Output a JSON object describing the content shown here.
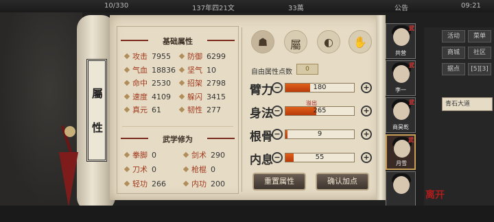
{
  "topbar": {
    "exp": "10/330",
    "time_label": "137年四21文",
    "coins": "33萬",
    "notice": "公告",
    "clock": "09:21"
  },
  "scroll_tag": [
    "屬",
    "性"
  ],
  "basic": {
    "title": "基础属性",
    "stats": [
      {
        "label": "攻击",
        "value": "7955"
      },
      {
        "label": "防御",
        "value": "6299"
      },
      {
        "label": "气血",
        "value": "18836"
      },
      {
        "label": "坚气",
        "value": "10"
      },
      {
        "label": "命中",
        "value": "2530"
      },
      {
        "label": "招架",
        "value": "2798"
      },
      {
        "label": "速度",
        "value": "4109"
      },
      {
        "label": "躲闪",
        "value": "3415"
      },
      {
        "label": "真元",
        "value": "61"
      },
      {
        "label": "韧性",
        "value": "277"
      }
    ]
  },
  "martial": {
    "title": "武学修为",
    "stats": [
      {
        "label": "拳脚",
        "value": "0"
      },
      {
        "label": "剑术",
        "value": "290"
      },
      {
        "label": "刀术",
        "value": "0"
      },
      {
        "label": "枪棍",
        "value": "0"
      },
      {
        "label": "轻功",
        "value": "266"
      },
      {
        "label": "内功",
        "value": "200"
      }
    ]
  },
  "tabs": [
    {
      "name": "character-tab",
      "glyph": "☗"
    },
    {
      "name": "attributes-tab",
      "glyph": "屬"
    },
    {
      "name": "skills-tab",
      "glyph": "◐"
    },
    {
      "name": "body-tab",
      "glyph": "✋"
    }
  ],
  "free_points": {
    "label": "自由属性点数",
    "value": "0"
  },
  "attributes": [
    {
      "name": "臂力",
      "value": "180",
      "fill": 0.36
    },
    {
      "name": "身法",
      "value": "265",
      "fill": 0.45
    },
    {
      "name": "根骨",
      "value": "9",
      "fill": 0.03
    },
    {
      "name": "内息",
      "value": "55",
      "fill": 0.12
    }
  ],
  "overflow_label": "溢出",
  "buttons": {
    "reset": "重置属性",
    "confirm": "确认加点"
  },
  "party": [
    {
      "name": "共营",
      "level": "武"
    },
    {
      "name": "李一",
      "level": "武"
    },
    {
      "name": "商昊乾",
      "level": "武"
    },
    {
      "name": "月雪",
      "level": "武"
    },
    {
      "name": "",
      "level": ""
    }
  ],
  "menu": {
    "items": [
      "活动",
      "菜单",
      "商城",
      "社区",
      "据点",
      "[5][3]"
    ],
    "quest": "青石大道"
  },
  "watermark": "离开"
}
